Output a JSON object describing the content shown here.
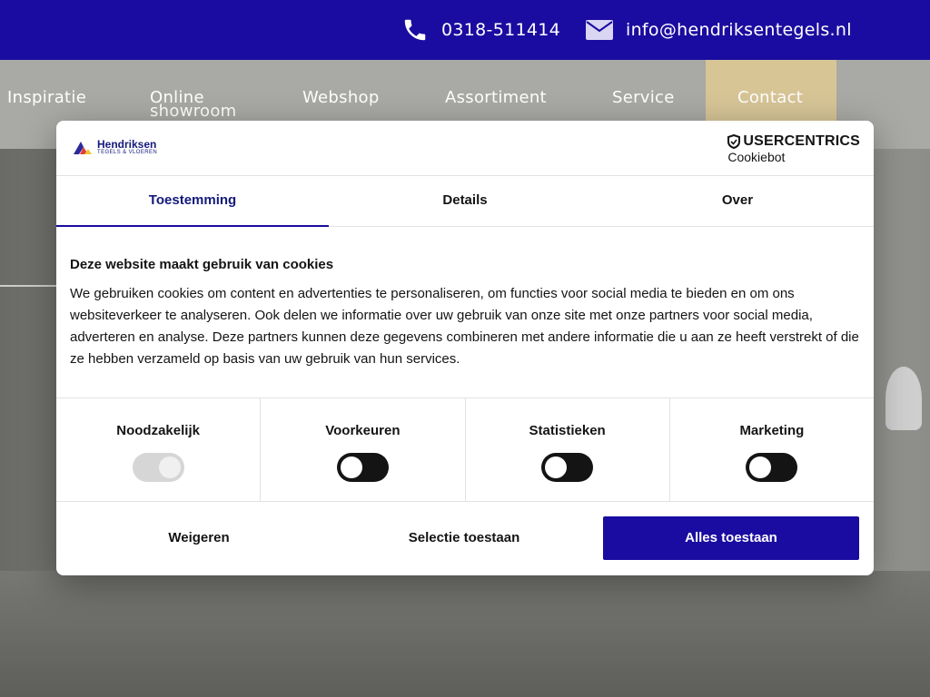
{
  "header": {
    "phone": "0318-511414",
    "email": "info@hendriksentegels.nl"
  },
  "nav": {
    "items": [
      {
        "label_line1": "Inspiratie",
        "label_line2": ""
      },
      {
        "label_line1": "Online",
        "label_line2": "showroom"
      },
      {
        "label_line1": "Webshop",
        "label_line2": ""
      },
      {
        "label_line1": "Assortiment",
        "label_line2": ""
      },
      {
        "label_line1": "Service",
        "label_line2": ""
      },
      {
        "label_line1": "Contact",
        "label_line2": ""
      }
    ],
    "contact_bg": "#d7c596"
  },
  "cookie_banner": {
    "logo_name": "Hendriksen",
    "logo_sub": "TEGELS & VLOEREN",
    "provider_brand": "USERCENTRICS",
    "provider_sub": "Cookiebot",
    "tabs": [
      "Toestemming",
      "Details",
      "Over"
    ],
    "active_tab": "Toestemming",
    "title": "Deze website maakt gebruik van cookies",
    "text": "We gebruiken cookies om content en advertenties te personaliseren, om functies voor social media te bieden en om ons websiteverkeer te analyseren. Ook delen we informatie over uw gebruik van onze site met onze partners voor social media, adverteren en analyse. Deze partners kunnen deze gegevens combineren met andere informatie die u aan ze heeft verstrekt of die ze hebben verzameld op basis van uw gebruik van hun services.",
    "categories": [
      {
        "label": "Noodzakelijk",
        "enabled": true,
        "disabled": true
      },
      {
        "label": "Voorkeuren",
        "enabled": false,
        "disabled": false
      },
      {
        "label": "Statistieken",
        "enabled": false,
        "disabled": false
      },
      {
        "label": "Marketing",
        "enabled": false,
        "disabled": false
      }
    ],
    "buttons": {
      "reject": "Weigeren",
      "allow_selection": "Selectie toestaan",
      "allow_all": "Alles toestaan"
    }
  },
  "colors": {
    "brand_blue": "#1a0ca0",
    "text": "#141414"
  },
  "icons": [
    "phone-icon",
    "mail-icon",
    "shield-icon"
  ]
}
